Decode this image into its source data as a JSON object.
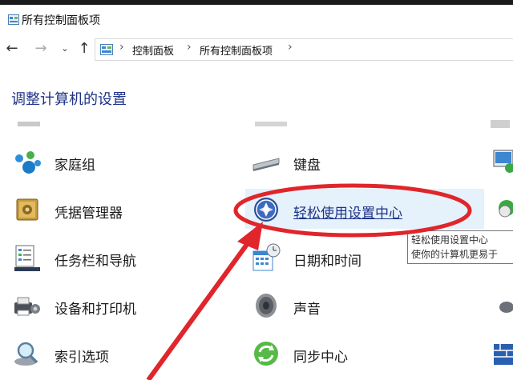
{
  "window": {
    "title": "所有控制面板项"
  },
  "nav": {
    "back_icon": "arrow-left-icon",
    "forward_icon": "arrow-right-icon",
    "recent_icon": "chevron-down-icon",
    "up_icon": "arrow-up-icon",
    "breadcrumb": [
      "控制面板",
      "所有控制面板项"
    ]
  },
  "heading": "调整计算机的设置",
  "items": {
    "homegroup": "家庭组",
    "keyboard": "键盘",
    "credential_manager": "凭据管理器",
    "ease_of_access": "轻松使用设置中心",
    "taskbar": "任务栏和导航",
    "datetime": "日期和时间",
    "devices_printers": "设备和打印机",
    "sound": "声音",
    "indexing": "索引选项",
    "sync_center": "同步中心"
  },
  "tooltip": {
    "line1": "轻松使用设置中心",
    "line2": "使你的计算机更易于"
  },
  "colors": {
    "link_blue": "#1e3287",
    "hover_bg": "#e5f1fb",
    "annotation_red": "#e0252b"
  }
}
